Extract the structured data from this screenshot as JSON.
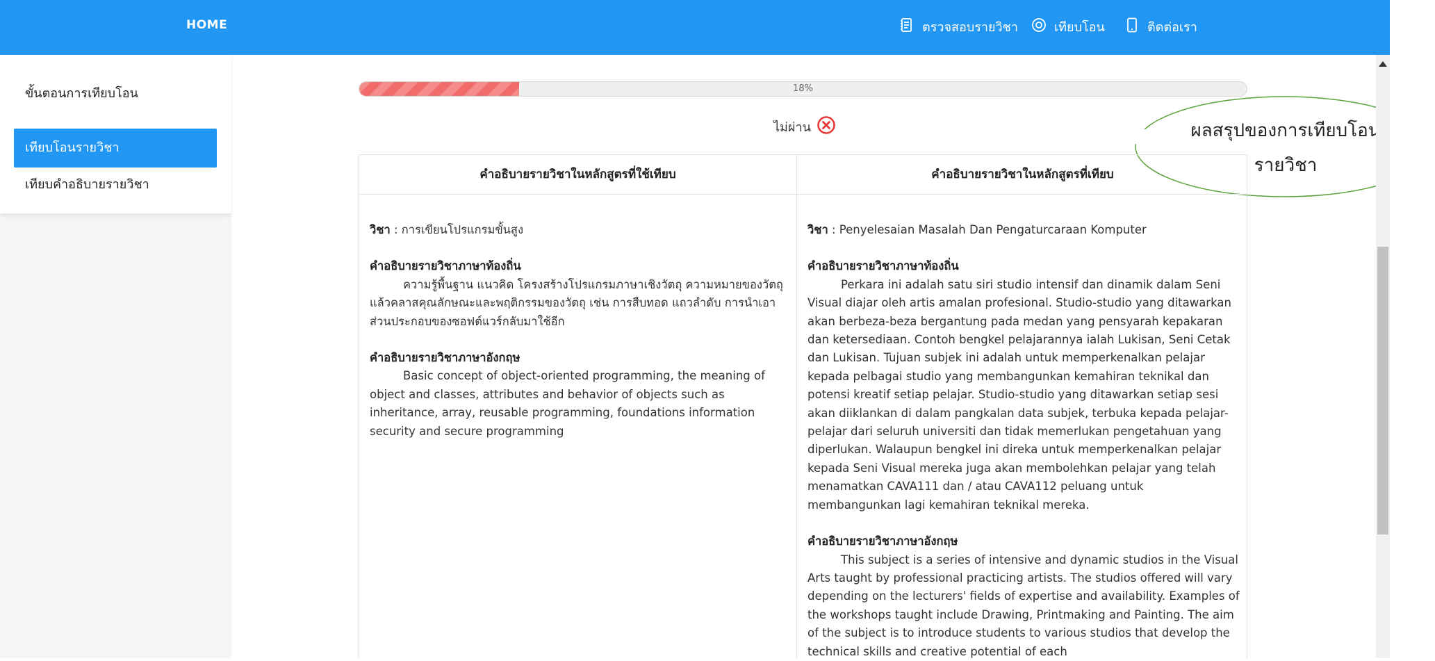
{
  "header": {
    "home": "HOME",
    "nav": [
      {
        "label": "ตรวจสอบรายวิชา",
        "icon": "document-icon"
      },
      {
        "label": "เทียบโอน",
        "icon": "target-icon"
      },
      {
        "label": "ติดต่อเรา",
        "icon": "phone-icon"
      }
    ]
  },
  "sidebar": {
    "items": [
      {
        "label": "ขั้นตอนการเทียบโอน"
      },
      {
        "label": "เทียบโอนรายวิชา",
        "active": true
      },
      {
        "label": "เทียบคำอธิบายรายวิชา"
      }
    ]
  },
  "progress": {
    "value": 0.18,
    "label": "18%"
  },
  "result": {
    "label": "ไม่ผ่าน",
    "icon": "fail-x-icon",
    "color": "#e53935"
  },
  "callout": {
    "line1": "ผลสรุปของการเทียบโอน",
    "line2": "รายวิชา"
  },
  "table": {
    "headers": [
      "คำอธิบายรายวิชาในหลักสูตรที่ใช้เทียบ",
      "คำอธิบายรายวิชาในหลักสูตรที่เทียบ"
    ],
    "left": {
      "course_label": "วิชา",
      "course_name": ": การเขียนโปรแกรมขั้นสูง",
      "local_head": "คำอธิบายรายวิชาภาษาท้องถิ่น",
      "local_desc": "ความรู้พื้นฐาน แนวคิด โครงสร้างโปรแกรมภาษาเชิงวัตถุ ความหมายของวัตถุแล้วคลาสคุณลักษณะและพฤติกรรมของวัตถุ เช่น การสืบทอด แถวลำดับ การนำเอาส่วนประกอบของซอฟต์แวร์กลับมาใช้อีก",
      "en_head": "คำอธิบายรายวิชาภาษาอังกฤษ",
      "en_desc": "Basic concept of object-oriented programming, the meaning of object and classes, attributes and behavior of objects such as inheritance, array, reusable programming, foundations information security and secure programming"
    },
    "right": {
      "course_label": "วิชา",
      "course_name": ": Penyelesaian Masalah Dan Pengaturcaraan Komputer",
      "local_head": "คำอธิบายรายวิชาภาษาท้องถิ่น",
      "local_desc": "Perkara ini adalah satu siri studio intensif dan dinamik dalam Seni Visual diajar oleh artis amalan profesional. Studio-studio yang ditawarkan akan berbeza-beza bergantung pada medan yang pensyarah kepakaran dan ketersediaan. Contoh bengkel pelajarannya ialah Lukisan, Seni Cetak dan Lukisan. Tujuan subjek ini adalah untuk memperkenalkan pelajar kepada pelbagai studio yang membangunkan kemahiran teknikal dan potensi kreatif setiap pelajar. Studio-studio yang ditawarkan setiap sesi akan diiklankan di dalam pangkalan data subjek, terbuka kepada pelajar-pelajar dari seluruh universiti dan tidak memerlukan pengetahuan yang diperlukan. Walaupun bengkel ini direka untuk memperkenalkan pelajar kepada Seni Visual mereka juga akan membolehkan pelajar yang telah menamatkan CAVA111 dan / atau CAVA112 peluang untuk membangunkan lagi kemahiran teknikal mereka.",
      "en_head": "คำอธิบายรายวิชาภาษาอังกฤษ",
      "en_desc": "This subject is a series of intensive and dynamic studios in the Visual Arts taught by professional practicing artists. The studios offered will vary depending on the lecturers' fields of expertise and availability. Examples of the workshops taught include Drawing, Printmaking and Painting. The aim of the subject is to introduce students to various studios that develop the technical skills and creative potential of each"
    }
  }
}
